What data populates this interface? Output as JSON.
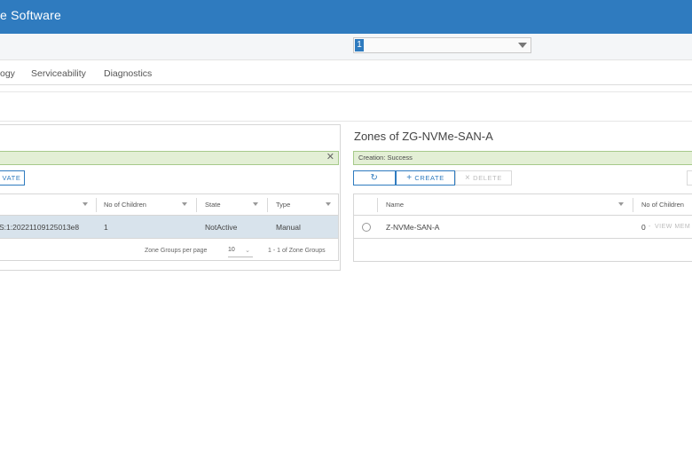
{
  "header": {
    "title": "e Software"
  },
  "subbar": {
    "select_value": "1"
  },
  "nav": {
    "tabs": [
      {
        "label": "ogy"
      },
      {
        "label": "Serviceability"
      },
      {
        "label": "Diagnostics"
      }
    ]
  },
  "left_panel": {
    "alert_text": "",
    "actions": {
      "activate_label": "VATE"
    },
    "columns": [
      {
        "label": "No of Children"
      },
      {
        "label": "State"
      },
      {
        "label": "Type"
      }
    ],
    "rows": [
      {
        "name": "S:1:20221109125013e8",
        "children": "1",
        "state": "NotActive",
        "type": "Manual"
      }
    ],
    "footer": {
      "per_page_label": "Zone Groups per page",
      "per_page_value": "10",
      "range_label": "1 - 1 of Zone Groups"
    }
  },
  "right_panel": {
    "title": "Zones of ZG-NVMe-SAN-A",
    "alert_text": "Creation: Success",
    "actions": {
      "create_label": "CREATE",
      "delete_label": "DELETE"
    },
    "columns": [
      {
        "label": "Name"
      },
      {
        "label": "No of Children"
      }
    ],
    "rows": [
      {
        "name": "Z-NVMe-SAN-A",
        "children": "0",
        "view_link": "VIEW MEM"
      }
    ]
  },
  "icons": {
    "refresh": "refresh-icon",
    "plus": "plus-icon",
    "close": "close-icon",
    "filter": "filter-icon",
    "caret": "chevron-down-icon"
  },
  "colors": {
    "accent": "#2f7bbf",
    "success_bg": "#e3efd5",
    "selected_row": "#d8e3ec"
  }
}
